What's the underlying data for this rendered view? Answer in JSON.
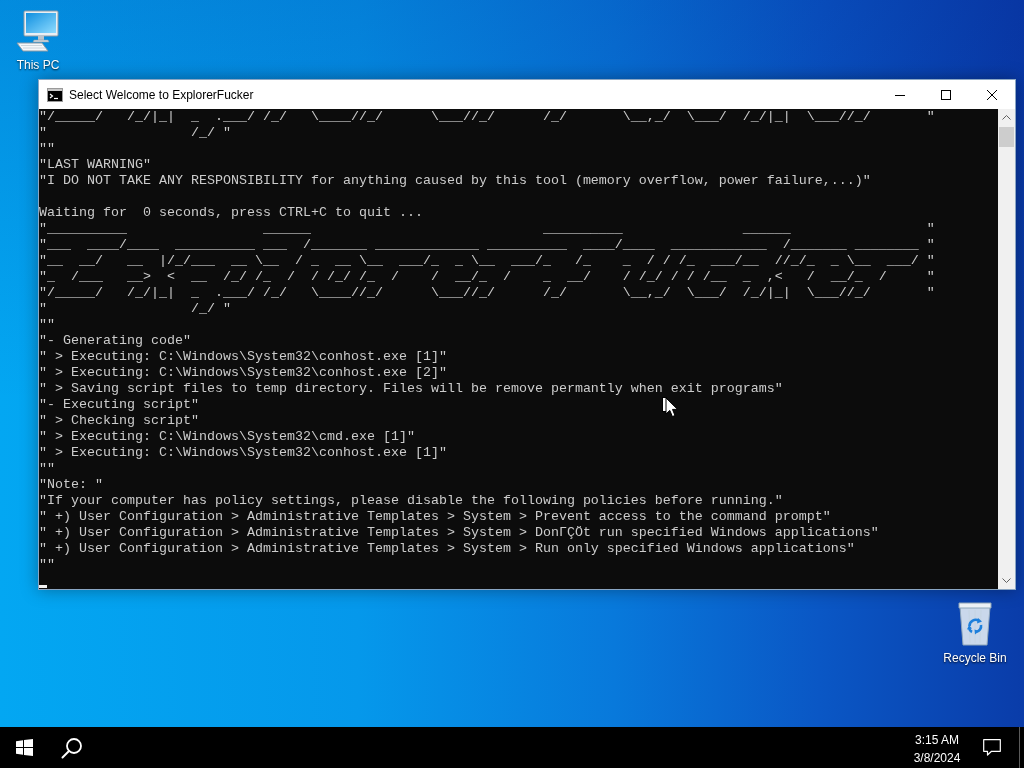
{
  "desktop": {
    "shortcuts": [
      {
        "kind": "computer",
        "label": "This PC"
      },
      {
        "kind": "recycle-bin",
        "label": "Recycle Bin"
      }
    ]
  },
  "window": {
    "title": "Select Welcome to ExplorerFucker",
    "console": {
      "blocks": [
        {
          "lines": [
            "\"/_____/   /_/|_|  _  .___/ /_/   \\____//_/      \\___//_/      /_/       \\__,_/  \\___/  /_/|_|  \\___//_/       \"",
            "\"                  /_/ \"",
            "\"\"",
            "\"LAST WARNING\"",
            "\"I DO NOT TAKE ANY RESPONSIBILITY for anything caused by this tool (memory overflow, power failure,...)\""
          ]
        },
        {
          "lines": [
            "Waiting for  0 seconds, press CTRL+C to quit ...",
            "\"__________                 ______                             __________               ______                 \"",
            "\"___  ____/____  __________ ___  /_______ _____________ __________  ____/____  ____________  /_______ ________ \"",
            "\"__  __/   __  |/_/___  __ \\__  / _  __ \\__  ___/_  _ \\__  ___/_   /_    _  / / /_  ___/__  //_/_  _ \\__  ___/ \"",
            "\"_  /___   __>  <  __  /_/ /_  /  / /_/ /_  /    /  __/_  /    _  __/    / /_/ / / /__  _  ,<   /  __/_  /     \"",
            "\"/_____/   /_/|_|  _  .___/ /_/   \\____//_/      \\___//_/      /_/       \\__,_/  \\___/  /_/|_|  \\___//_/       \"",
            "\"                  /_/ \"",
            "\"\"",
            "\"- Generating code\"",
            "\" > Executing: C:\\Windows\\System32\\conhost.exe [1]\"",
            "\" > Executing: C:\\Windows\\System32\\conhost.exe [2]\"",
            "\" > Saving script files to temp directory. Files will be remove permantly when exit programs\"",
            "\"- Executing script\"",
            "\" > Checking script\"",
            "\" > Executing: C:\\Windows\\System32\\cmd.exe [1]\"",
            "\" > Executing: C:\\Windows\\System32\\conhost.exe [1]\"",
            "\"\"",
            "\"Note: \"",
            "\"If your computer has policy settings, please disable the following policies before running.\"",
            "\" +) User Configuration > Administrative Templates > System > Prevent access to the command prompt\"",
            "\" +) User Configuration > Administrative Templates > System > DonΓÇÖt run specified Windows applications\"",
            "\" +) User Configuration > Administrative Templates > System > Run only specified Windows applications\"",
            "\"\""
          ]
        }
      ]
    }
  },
  "taskbar": {
    "time": "3:15 AM",
    "date": "3/8/2024"
  }
}
